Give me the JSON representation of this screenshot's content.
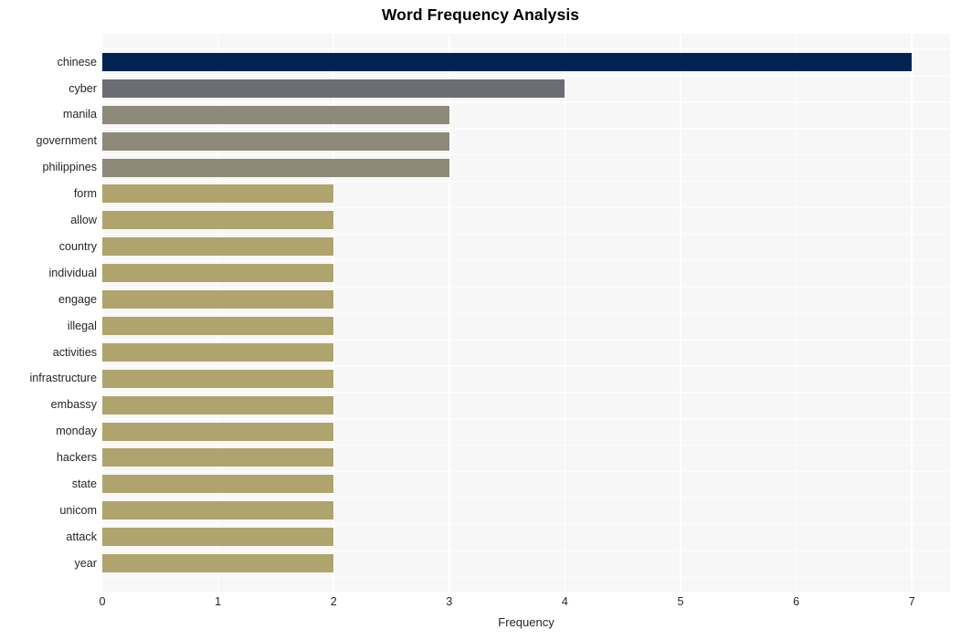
{
  "chart_data": {
    "type": "bar",
    "orientation": "horizontal",
    "title": "Word Frequency Analysis",
    "xlabel": "Frequency",
    "ylabel": "",
    "xlim": [
      0,
      7.33
    ],
    "xticks": [
      0,
      1,
      2,
      3,
      4,
      5,
      6,
      7
    ],
    "xticklabels": [
      "0",
      "1",
      "2",
      "3",
      "4",
      "5",
      "6",
      "7"
    ],
    "grid": true,
    "grid_color": "#ffffff",
    "plot_background": "#f7f7f7",
    "figure_background": "#ffffff",
    "legend": null,
    "categories": [
      "chinese",
      "cyber",
      "manila",
      "government",
      "philippines",
      "form",
      "allow",
      "country",
      "individual",
      "engage",
      "illegal",
      "activities",
      "infrastructure",
      "embassy",
      "monday",
      "hackers",
      "state",
      "unicom",
      "attack",
      "year"
    ],
    "values": [
      7,
      4,
      3,
      3,
      3,
      2,
      2,
      2,
      2,
      2,
      2,
      2,
      2,
      2,
      2,
      2,
      2,
      2,
      2,
      2
    ],
    "bar_colors": [
      "#012351",
      "#6b6d73",
      "#8d8a7a",
      "#8d8a7a",
      "#8d8a7a",
      "#afa46e",
      "#afa46e",
      "#afa46e",
      "#afa46e",
      "#afa46e",
      "#afa46e",
      "#afa46e",
      "#afa46e",
      "#afa46e",
      "#afa46e",
      "#afa46e",
      "#afa46e",
      "#afa46e",
      "#afa46e",
      "#afa46e"
    ]
  }
}
